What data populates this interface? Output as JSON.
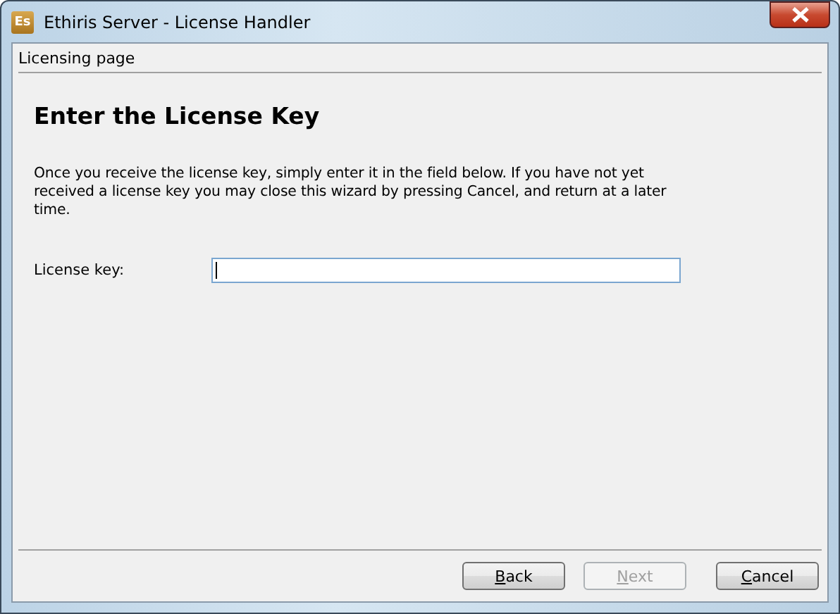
{
  "window": {
    "title": "Ethiris Server - License Handler",
    "app_icon": "Es"
  },
  "page_header": "Licensing page",
  "heading": "Enter the License Key",
  "description": "Once you receive the license key, simply enter it in the field below. If you have not yet received a license key you may close this wizard by pressing Cancel, and return at a later time.",
  "field": {
    "label": "License key:",
    "focused": true
  },
  "buttons": [
    {
      "mnemonic": "B",
      "rest": "ack",
      "disabled": false
    },
    {
      "mnemonic": "N",
      "rest": "ext",
      "disabled": true
    },
    {
      "mnemonic": "C",
      "rest": "ancel",
      "disabled": false
    }
  ]
}
